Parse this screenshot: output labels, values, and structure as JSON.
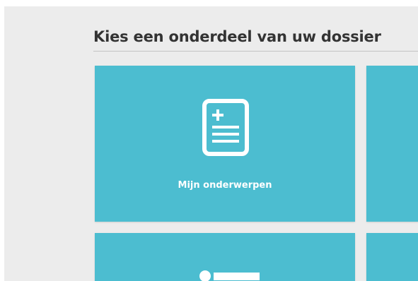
{
  "page": {
    "section_title": "Kies een onderdeel van uw dossier"
  },
  "tiles": [
    {
      "label": "Mijn onderwerpen",
      "icon": "document-plus-icon"
    },
    {
      "label": "",
      "icon": ""
    },
    {
      "label": "",
      "icon": "bullet-list-icon"
    },
    {
      "label": "",
      "icon": ""
    }
  ],
  "colors": {
    "tile_background": "#4cbdd0",
    "page_background": "#ececec",
    "title_text": "#333333",
    "tile_text": "#ffffff"
  }
}
